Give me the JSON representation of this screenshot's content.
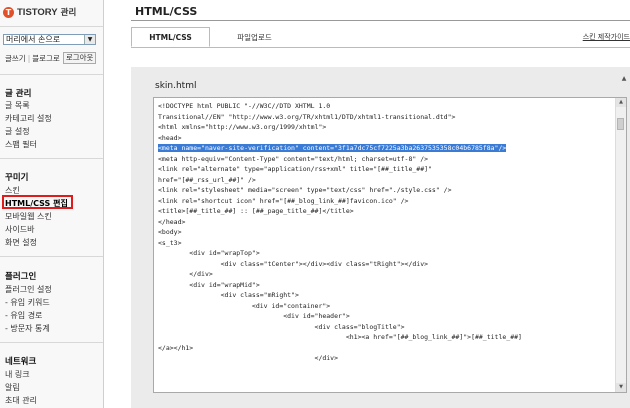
{
  "brand": {
    "name": "TISTORY",
    "sub": "관리"
  },
  "sidebar": {
    "select_value": "머리에서 손으로",
    "toplinks": [
      "글쓰기",
      "블로그로"
    ],
    "logout": "로그아웃",
    "sections": [
      {
        "title": "글 관리",
        "items": [
          "글 목록",
          "카테고리 설정",
          "글 설정",
          "스팸 필터"
        ]
      },
      {
        "title": "꾸미기",
        "items": [
          "스킨",
          "HTML/CSS 편집",
          "모바일웹 스킨",
          "사이드바",
          "화면 설정"
        ]
      },
      {
        "title": "플러그인",
        "items": [
          "플러그인 설정",
          "- 유입 키워드",
          "- 유입 경로",
          "- 방문자 통계"
        ]
      },
      {
        "title": "네트워크",
        "items": [
          "내 링크",
          "알림",
          "초대 관리"
        ]
      }
    ]
  },
  "main": {
    "title": "HTML/CSS",
    "tabs": [
      "HTML/CSS",
      "파일업로드"
    ],
    "skin_link": "스킨 제작가이드",
    "file_label": "skin.html",
    "code_lines": [
      "<!DOCTYPE html PUBLIC \"-//W3C//DTD XHTML 1.0",
      "Transitional//EN\" \"http://www.w3.org/TR/xhtml1/DTD/xhtml1-transitional.dtd\">",
      "<html xmlns=\"http://www.w3.org/1999/xhtml\">",
      "<head>",
      "<meta name=\"naver-site-verification\" content=\"3f1a7dc75cf7225a3ba2637535358c04b6785f8a\"/>",
      "<meta http-equiv=\"Content-Type\" content=\"text/html; charset=utf-8\" />",
      "<link rel=\"alternate\" type=\"application/rss+xml\" title=\"[##_title_##]\"",
      "href=\"[##_rss_url_##]\" />",
      "<link rel=\"stylesheet\" media=\"screen\" type=\"text/css\" href=\"./style.css\" />",
      "<link rel=\"shortcut icon\" href=\"[##_blog_link_##]favicon.ico\" />",
      "<title>[##_title_##] :: [##_page_title_##]</title>",
      "</head>",
      "<body>",
      "<s_t3>",
      "        <div id=\"wrapTop\">",
      "                <div class=\"tCenter\"></div><div class=\"tRight\"></div>",
      "        </div>",
      "        <div id=\"wrapMid\">",
      "                <div class=\"mRight\">",
      "                        <div id=\"container\">",
      "                                <div id=\"header\">",
      "                                        <div class=\"blogTitle\">",
      "                                                <h1><a href=\"[##_blog_link_##]\">[##_title_##]",
      "</a></h1>",
      "                                        </div>"
    ],
    "highlighted_line": 4
  }
}
